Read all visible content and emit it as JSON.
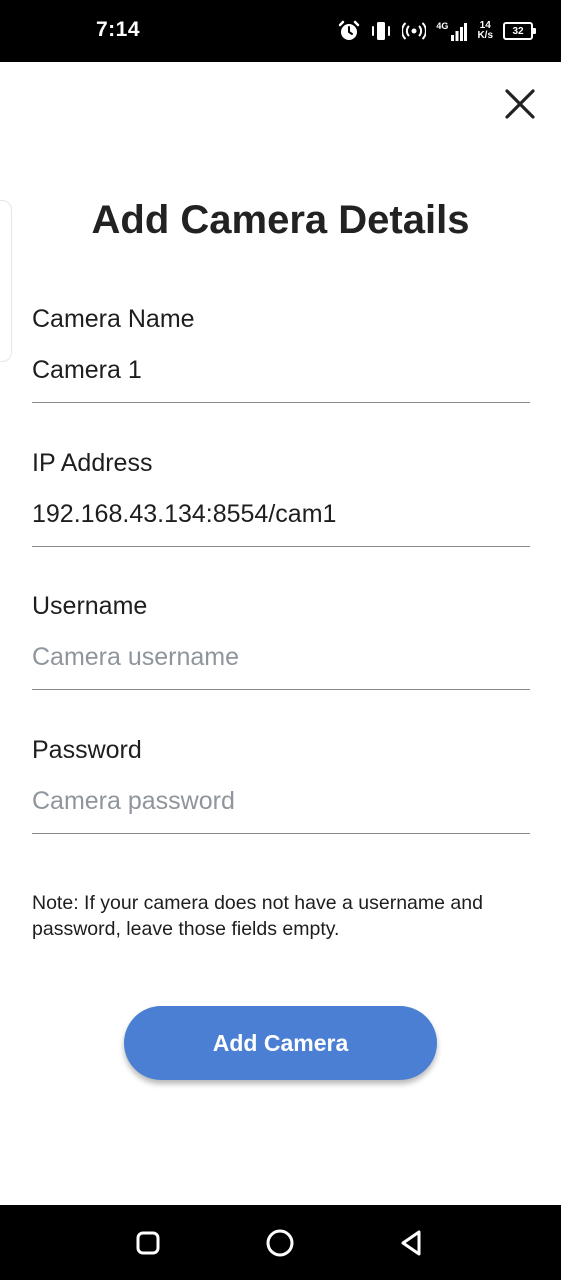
{
  "status_bar": {
    "time": "7:14",
    "network_type": "4G",
    "net_speed_value": "14",
    "net_speed_unit": "K/s",
    "battery_level": "32"
  },
  "dialog": {
    "title": "Add Camera Details",
    "fields": [
      {
        "label": "Camera Name",
        "value": "Camera 1",
        "placeholder": ""
      },
      {
        "label": "IP Address",
        "value": "192.168.43.134:8554/cam1",
        "placeholder": ""
      },
      {
        "label": "Username",
        "value": "",
        "placeholder": "Camera username"
      },
      {
        "label": "Password",
        "value": "",
        "placeholder": "Camera password"
      }
    ],
    "note": "Note: If your camera does not have a username and password, leave those fields empty.",
    "submit_label": "Add Camera"
  },
  "colors": {
    "primary_button": "#4a7fd4",
    "placeholder": "#8f959c",
    "underline": "#8a8a8a"
  },
  "icons": {
    "close": "close-icon",
    "alarm": "alarm-icon",
    "vibrate": "vibrate-icon",
    "hotspot": "hotspot-icon",
    "signal": "signal-icon",
    "battery": "battery-icon",
    "nav_recents": "recents-icon",
    "nav_home": "home-icon",
    "nav_back": "back-icon"
  }
}
